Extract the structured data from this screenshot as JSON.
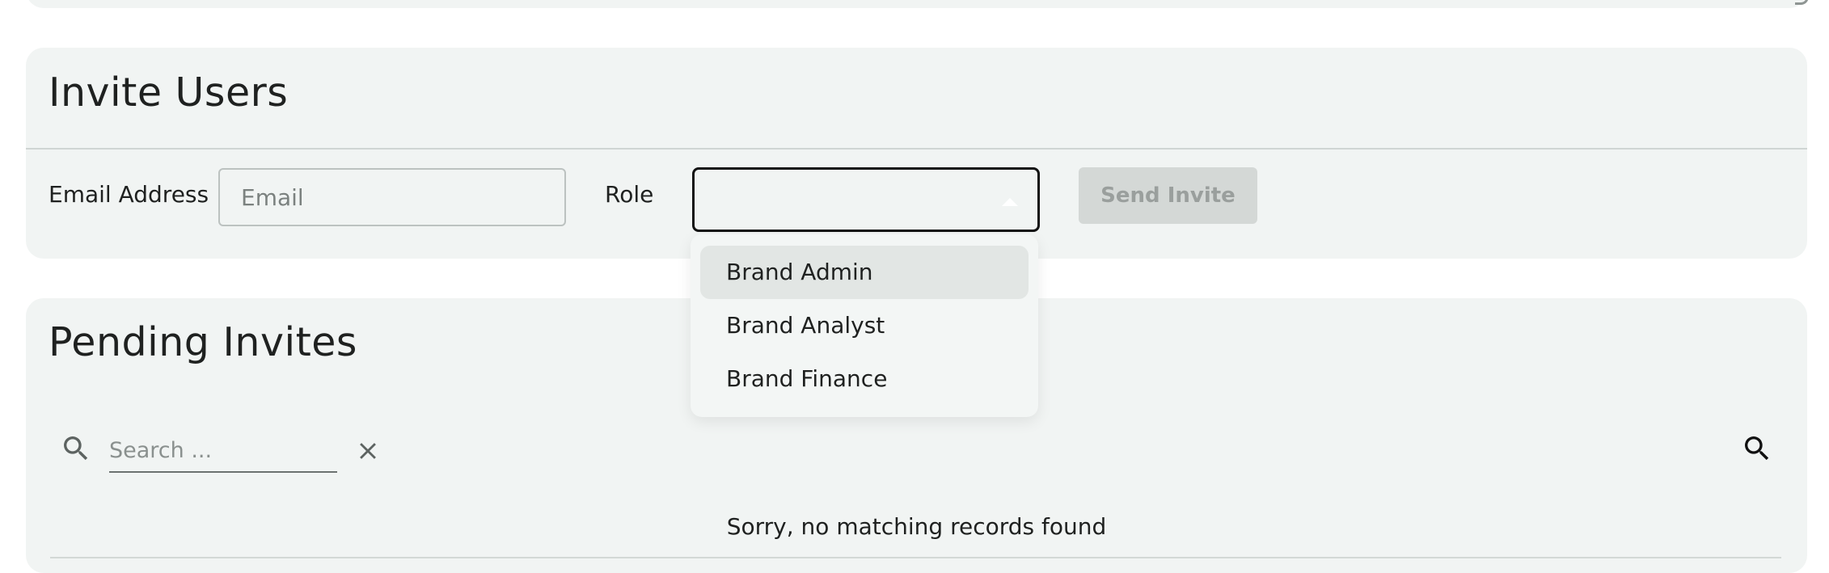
{
  "invite": {
    "title": "Invite Users",
    "email_label": "Email Address",
    "email_value": "",
    "email_placeholder": "Email",
    "role_label": "Role",
    "role_value": "",
    "send_label": "Send Invite"
  },
  "role_menu": {
    "items": [
      {
        "label": "Brand Admin"
      },
      {
        "label": "Brand Analyst"
      },
      {
        "label": "Brand Finance"
      }
    ]
  },
  "pending": {
    "title": "Pending Invites",
    "search_placeholder": "Search ...",
    "search_value": "",
    "empty_message": "Sorry, no matching records found"
  },
  "icons": {
    "search_left": "search-icon",
    "clear": "close-icon",
    "search_right": "search-icon"
  },
  "colors": {
    "card_bg": "#f1f4f3",
    "text": "#1f2120",
    "button_disabled_bg": "#d4d8d6",
    "button_disabled_text": "#9a9f9d",
    "menu_highlight": "#e2e6e4"
  }
}
